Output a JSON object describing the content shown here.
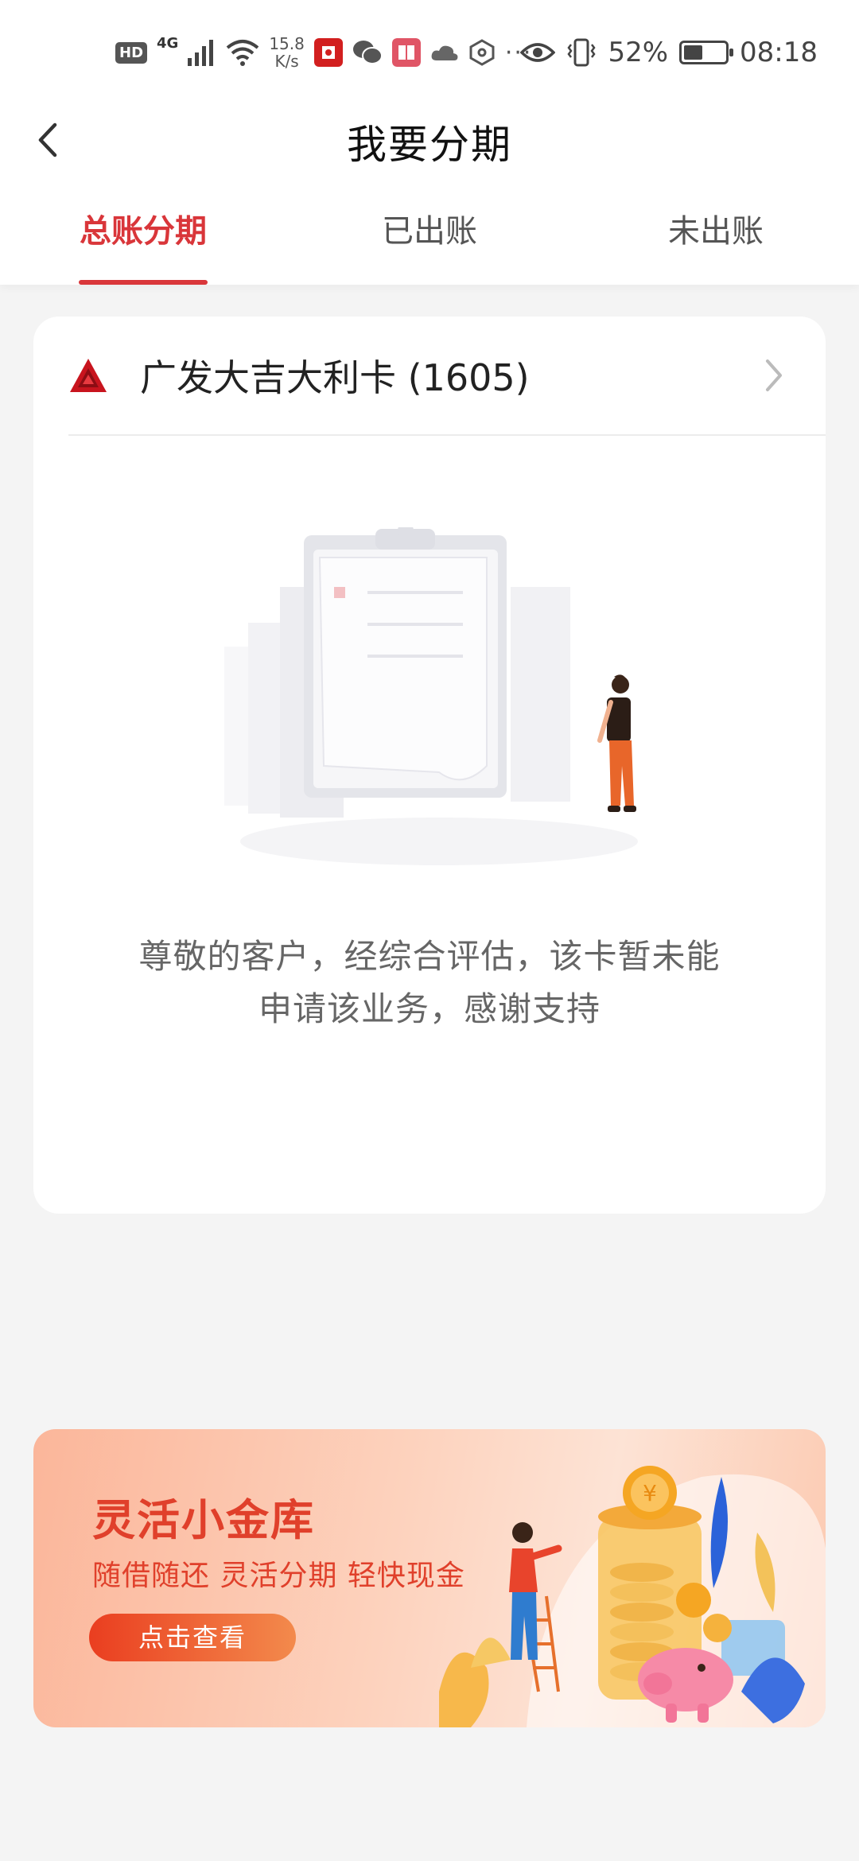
{
  "status_bar": {
    "hd": "HD",
    "network": "4G",
    "speed_value": "15.8",
    "speed_unit": "K/s",
    "more": "···",
    "battery_percent": "52%",
    "battery_level": 0.52,
    "time": "08:18"
  },
  "nav": {
    "title": "我要分期"
  },
  "tabs": [
    {
      "label": "总账分期",
      "active": true
    },
    {
      "label": "已出账",
      "active": false
    },
    {
      "label": "未出账",
      "active": false
    }
  ],
  "card": {
    "name": "广发大吉大利卡 (1605)",
    "message_line1": "尊敬的客户，经综合评估，该卡暂未能",
    "message_line2": "申请该业务，感谢支持"
  },
  "banner": {
    "title": "灵活小金库",
    "subtitle": "随借随还 灵活分期 轻快现金",
    "button": "点击查看"
  },
  "colors": {
    "accent": "#d9363a",
    "banner_text": "#e0402b"
  },
  "icons": {
    "back": "chevron-left-icon",
    "card_arrow": "chevron-right-icon",
    "bank_logo": "cgb-logo-icon"
  }
}
